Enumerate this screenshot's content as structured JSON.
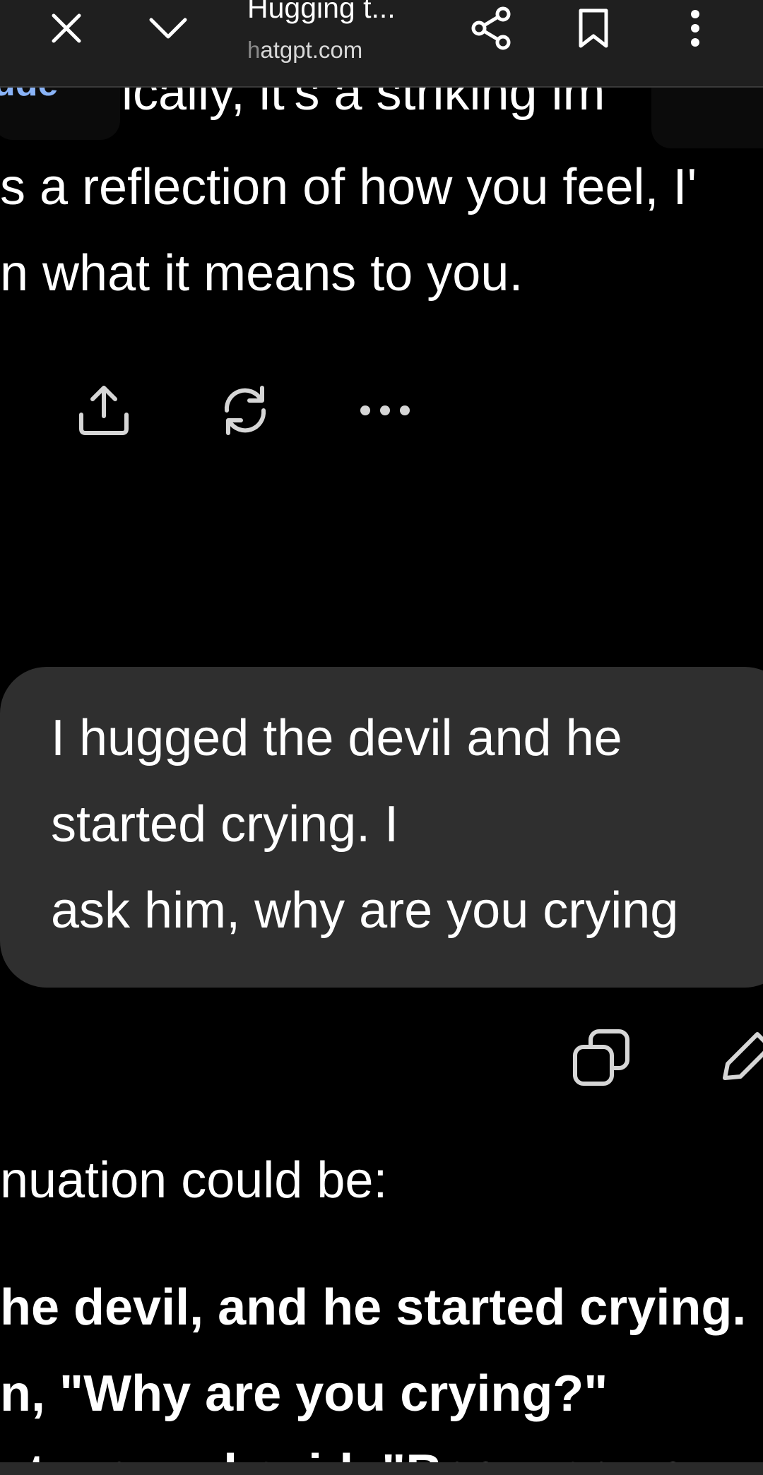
{
  "topbar": {
    "title": "Hugging t...",
    "url_prefix": "h",
    "url_rest": "atgpt.com",
    "icons": [
      "close-icon",
      "chevron-down-icon",
      "share-icon",
      "bookmark-icon",
      "more-vert-icon"
    ]
  },
  "assistant_prev": {
    "cut_line": "ically, it's a striking im",
    "badge_text": "ude",
    "lines": [
      "s a reflection of how you feel, I'",
      "n what it means to you."
    ],
    "actions": [
      "share-icon",
      "regenerate-icon",
      "more-horiz-icon"
    ]
  },
  "user_message": {
    "lines": [
      "I hugged the devil and he",
      "started crying.                 I",
      "ask him, why are you crying"
    ],
    "actions": [
      "copy-icon",
      "edit-icon"
    ]
  },
  "assistant_next": {
    "intro": "nuation could be:",
    "bold_lines": [
      "he devil, and he started crying.",
      "n, \"Why are you crying?\"",
      "at me and said, \"Because you"
    ]
  },
  "colors": {
    "background": "#000000",
    "bubble": "#2f2f2f",
    "topbar": "#1f1f1f",
    "text": "#ffffff",
    "accent_link": "#8ab4f8"
  }
}
